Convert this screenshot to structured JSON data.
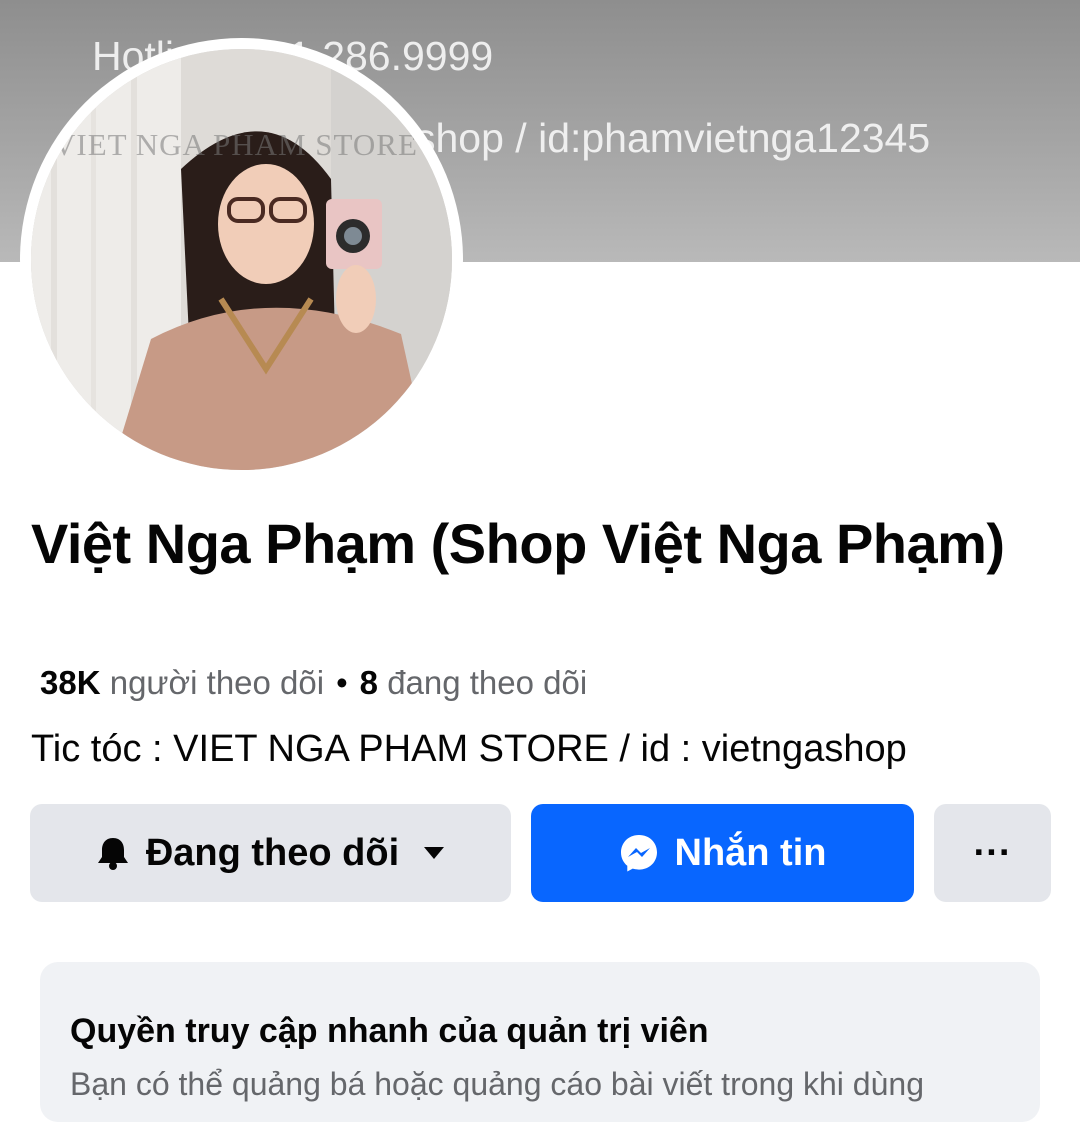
{
  "cover": {
    "line1": "Hotline: 091.286.9999",
    "line2": "shop / id:phamvietnga12345"
  },
  "avatar": {
    "watermark": "VIET NGA PHAM STORE"
  },
  "profile": {
    "name": "Việt Nga Phạm (Shop Việt Nga Phạm)",
    "followers_count": "38K",
    "followers_label": "người theo dõi",
    "separator": "•",
    "following_count": "8",
    "following_label": "đang theo dõi",
    "bio": "Tic tóc : VIET NGA PHAM STORE / id : vietngashop"
  },
  "actions": {
    "follow_label": "Đang theo dõi",
    "message_label": "Nhắn tin",
    "more_label": "···"
  },
  "admin_card": {
    "title": "Quyền truy cập nhanh của quản trị viên",
    "description": "Bạn có thể quảng bá hoặc quảng cáo bài viết trong khi dùng"
  },
  "icons": {
    "follow": "bell-icon",
    "dropdown": "caret-down-icon",
    "message": "messenger-icon",
    "more": "more-dots-icon"
  },
  "colors": {
    "primary": "#0866ff",
    "secondary_button": "#e4e6eb",
    "text": "#050505",
    "muted_text": "#65676b",
    "card_bg": "#f0f2f5"
  }
}
